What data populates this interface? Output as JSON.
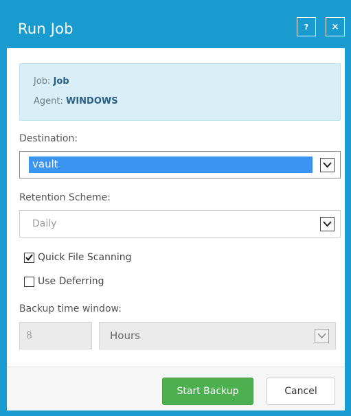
{
  "dialog": {
    "title": "Run Job",
    "help_label": "?",
    "close_label": "×"
  },
  "info": {
    "job_label": "Job:",
    "job_value": "Job",
    "agent_label": "Agent:",
    "agent_value": "WINDOWS"
  },
  "destination": {
    "label": "Destination:",
    "value": "vault"
  },
  "retention": {
    "label": "Retention Scheme:",
    "value": "Daily"
  },
  "options": {
    "quick_scan_label": "Quick File Scanning",
    "quick_scan_checked": true,
    "deferring_label": "Use Deferring",
    "deferring_checked": false
  },
  "time_window": {
    "label": "Backup time window:",
    "value": "8",
    "unit": "Hours"
  },
  "footer": {
    "start_label": "Start Backup",
    "cancel_label": "Cancel"
  },
  "colors": {
    "titlebar": "#1a9bd0",
    "start_button": "#4caf50",
    "selection": "#3b95f0"
  },
  "icons": {
    "dropdown": "chevron-down-icon",
    "check": "checkmark-icon"
  }
}
